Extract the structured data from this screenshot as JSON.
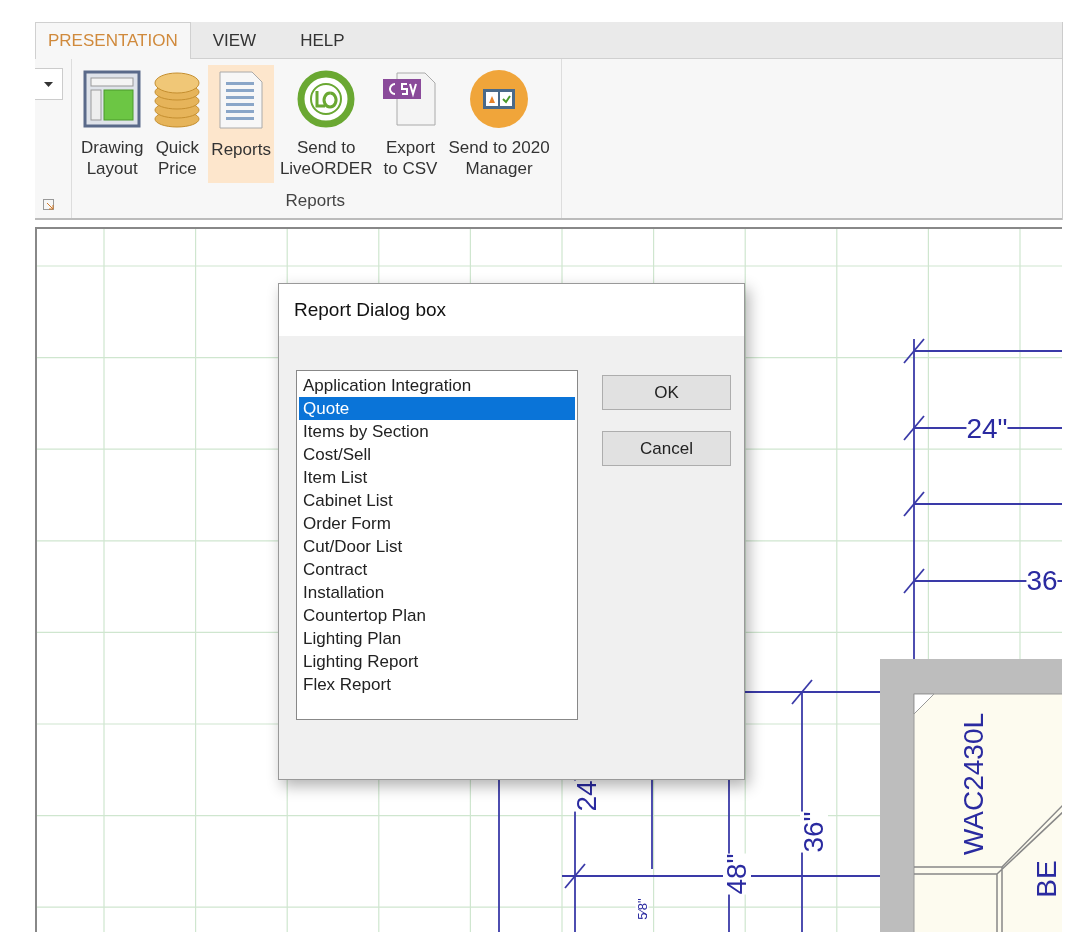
{
  "ribbon": {
    "tabs": [
      {
        "label": "PRESENTATION",
        "selected": true
      },
      {
        "label": "VIEW",
        "selected": false
      },
      {
        "label": "HELP",
        "selected": false
      }
    ],
    "buttons": [
      {
        "kind": "layout",
        "lines": [
          "Drawing",
          "Layout"
        ],
        "selected": false
      },
      {
        "kind": "coins",
        "lines": [
          "Quick",
          "Price"
        ],
        "selected": false
      },
      {
        "kind": "report",
        "lines": [
          "Reports"
        ],
        "selected": true
      },
      {
        "kind": "lo",
        "lines": [
          "Send to",
          "LiveORDER"
        ],
        "selected": false
      },
      {
        "kind": "csv",
        "lines": [
          "Export",
          "to CSV"
        ],
        "selected": false
      },
      {
        "kind": "manager",
        "lines": [
          "Send to 2020",
          "Manager"
        ],
        "selected": false
      }
    ],
    "group_label": "Reports"
  },
  "canvas": {
    "dimension_labels": [
      {
        "text": "24\"",
        "rotated": false
      },
      {
        "text": "36",
        "rotated": false
      },
      {
        "text": "24",
        "rotated": true
      },
      {
        "text": "48\"",
        "rotated": true
      },
      {
        "text": "36\"",
        "rotated": true
      },
      {
        "text": "5⁄8\"",
        "rotated": true
      }
    ],
    "cabinet_labels": [
      "WAC2430L",
      "BE"
    ]
  },
  "dialog": {
    "title": "Report Dialog box",
    "items": [
      {
        "label": "Application Integration",
        "selected": false
      },
      {
        "label": "Quote",
        "selected": true
      },
      {
        "label": "Items by Section",
        "selected": false
      },
      {
        "label": "Cost/Sell",
        "selected": false
      },
      {
        "label": "Item List",
        "selected": false
      },
      {
        "label": "Cabinet List",
        "selected": false
      },
      {
        "label": "Order Form",
        "selected": false
      },
      {
        "label": "Cut/Door List",
        "selected": false
      },
      {
        "label": "Contract",
        "selected": false
      },
      {
        "label": "Installation",
        "selected": false
      },
      {
        "label": "Countertop Plan",
        "selected": false
      },
      {
        "label": "Lighting Plan",
        "selected": false
      },
      {
        "label": "Lighting Report",
        "selected": false
      },
      {
        "label": "Flex Report",
        "selected": false
      }
    ],
    "buttons": [
      "OK",
      "Cancel"
    ]
  }
}
